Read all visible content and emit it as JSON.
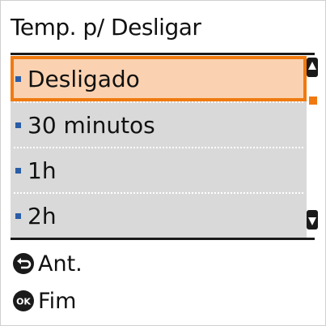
{
  "title": "Temp. p/ Desligar",
  "options": [
    {
      "label": "Desligado",
      "selected": true
    },
    {
      "label": "30 minutos",
      "selected": false
    },
    {
      "label": "1h",
      "selected": false
    },
    {
      "label": "2h",
      "selected": false
    }
  ],
  "softkeys": {
    "back_label": "Ant.",
    "ok_label": "Fim"
  },
  "icons": {
    "back": "back-arrow-icon",
    "ok": "ok-icon",
    "scroll_up": "scroll-up-arrow-icon",
    "scroll_down": "scroll-down-arrow-icon"
  },
  "colors": {
    "highlight_fill": "#fbd2b1",
    "highlight_border": "#f07a10",
    "list_background": "#d9d9d9",
    "bullet": "#2a5da8"
  }
}
